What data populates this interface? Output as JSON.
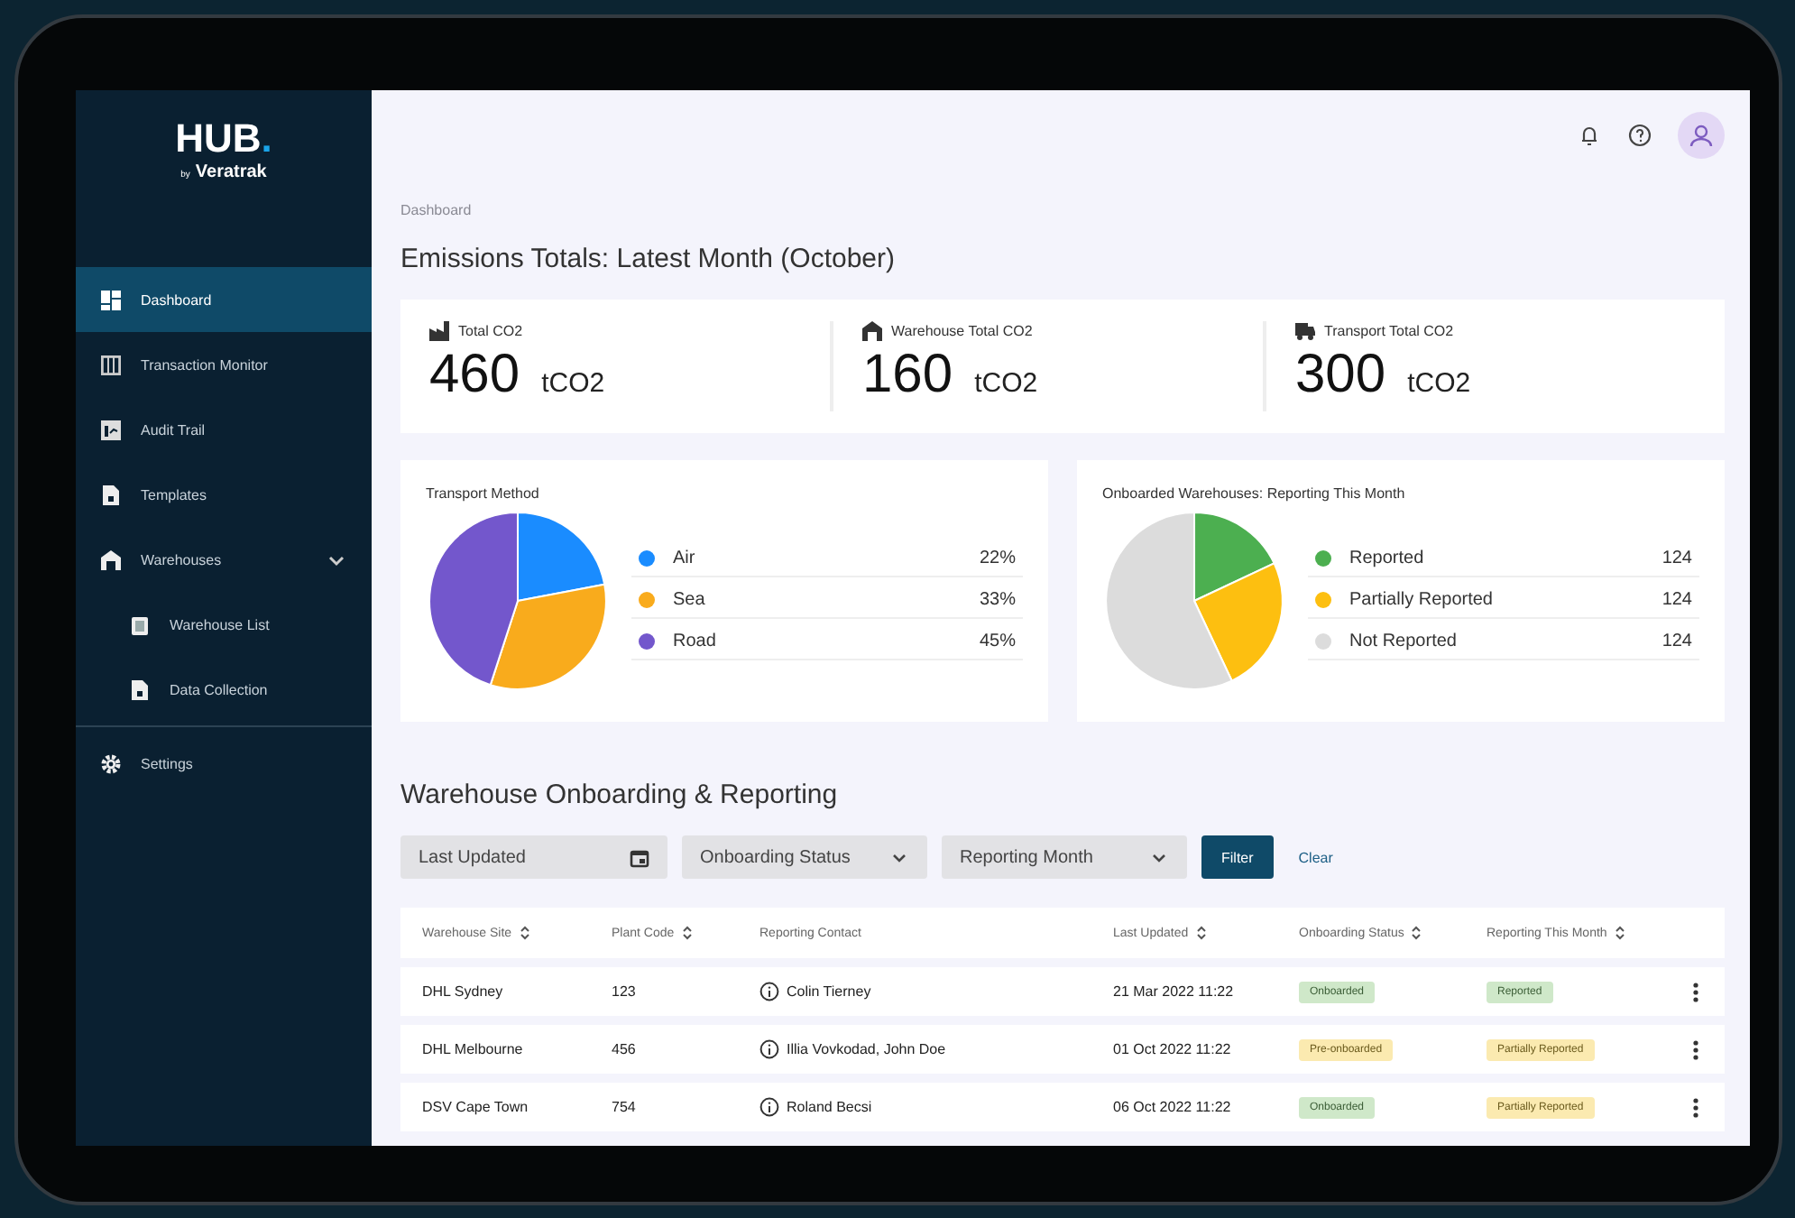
{
  "brand": {
    "name": "HUB",
    "dot": ".",
    "by": "by",
    "company": "Veratrak"
  },
  "sidebar": {
    "items": [
      {
        "label": "Dashboard",
        "selected": true
      },
      {
        "label": "Transaction Monitor",
        "selected": false
      },
      {
        "label": "Audit Trail",
        "selected": false
      },
      {
        "label": "Templates",
        "selected": false
      },
      {
        "label": "Warehouses",
        "selected": false,
        "expanded": true,
        "children": [
          {
            "label": "Warehouse List",
            "selected": false
          },
          {
            "label": "Data Collection",
            "selected": false
          }
        ]
      }
    ],
    "footer_items": [
      {
        "label": "Settings",
        "selected": false
      }
    ]
  },
  "breadcrumb": "Dashboard",
  "title": "Emissions Totals: Latest Month (October)",
  "totals": [
    {
      "label": "Total CO2",
      "value": "460",
      "unit": "tCO2"
    },
    {
      "label": "Warehouse Total CO2",
      "value": "160",
      "unit": "tCO2"
    },
    {
      "label": "Transport Total CO2",
      "value": "300",
      "unit": "tCO2"
    }
  ],
  "transport_method": {
    "title": "Transport Method",
    "chart_data": {
      "type": "pie",
      "categories": [
        "Air",
        "Sea",
        "Road"
      ],
      "values": [
        22,
        33,
        45
      ]
    },
    "legend": [
      {
        "value": "22%",
        "color": "#1a8cff"
      },
      {
        "value": "33%",
        "color": "#f9ab1c"
      },
      {
        "value": "45%",
        "color": "#7357cc"
      }
    ]
  },
  "warehouse_reporting": {
    "title": "Onboarded Warehouses: Reporting This Month",
    "legend": [
      {
        "label": "Reported",
        "value": "124",
        "color": "#4caf50"
      },
      {
        "label": "Partially Reported",
        "value": "124",
        "color": "#fdbf10"
      },
      {
        "label": "Not Reported",
        "value": "124",
        "color": "#dcdcdc"
      }
    ]
  },
  "section_title": "Warehouse Onboarding & Reporting",
  "filters": [
    {
      "kind": "date",
      "label": "Last Updated"
    },
    {
      "kind": "select",
      "label": "Onboarding Status"
    },
    {
      "kind": "select",
      "label": "Reporting Month"
    }
  ],
  "filter_button": "Filter",
  "clear_link": "Clear",
  "table": {
    "columns": [
      {
        "label": "Warehouse Site",
        "sortable": true
      },
      {
        "label": "Plant Code",
        "sortable": true
      },
      {
        "label": "Reporting Contact",
        "sortable": false
      },
      {
        "label": "Last Updated",
        "sortable": true
      },
      {
        "label": "Onboarding Status",
        "sortable": true
      },
      {
        "label": "Reporting This Month",
        "sortable": true
      }
    ],
    "rows": [
      {
        "site": "DHL Sydney",
        "code": "123",
        "contact": "Colin Tierney",
        "updated": "21 Mar 2022 11:22",
        "onboarding": {
          "text": "Onboarded",
          "kind": "success"
        },
        "reporting": {
          "text": "Reported",
          "kind": "success"
        }
      },
      {
        "site": "DHL Melbourne",
        "code": "456",
        "contact": "Illia Vovkodad, John Doe",
        "updated": "01 Oct 2022 11:22",
        "onboarding": {
          "text": "Pre-onboarded",
          "kind": "warning"
        },
        "reporting": {
          "text": "Partially Reported",
          "kind": "warning"
        }
      },
      {
        "site": "DSV Cape Town",
        "code": "754",
        "contact": "Roland Becsi",
        "updated": "06 Oct 2022 11:22",
        "onboarding": {
          "text": "Onboarded",
          "kind": "success"
        },
        "reporting": {
          "text": "Partially Reported",
          "kind": "warning"
        }
      }
    ]
  }
}
